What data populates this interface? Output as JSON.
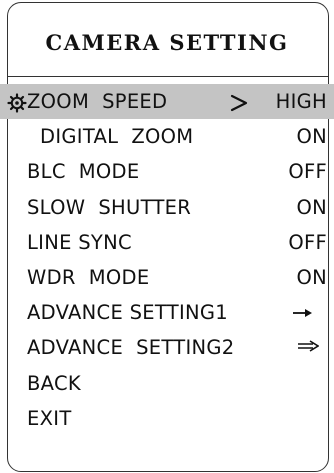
{
  "title": "CAMERA SETTING",
  "menu": {
    "items": [
      {
        "label": "ZOOM  SPEED",
        "value": "HIGH",
        "selected_icon": "gear-icon",
        "pointer_icon": "chevron-right-icon"
      },
      {
        "label": "DIGITAL  ZOOM",
        "value": "ON"
      },
      {
        "label": "BLC  MODE",
        "value": "OFF"
      },
      {
        "label": "SLOW  SHUTTER",
        "value": "ON"
      },
      {
        "label": "LINE SYNC",
        "value": "OFF"
      },
      {
        "label": "WDR  MODE",
        "value": "ON"
      },
      {
        "label": "ADVANCE SETTING1",
        "submenu_icon": "arrow-right-icon"
      },
      {
        "label": "ADVANCE  SETTING2",
        "submenu_icon": "arrow-right-icon"
      },
      {
        "label": "BACK"
      },
      {
        "label": "EXIT"
      }
    ]
  },
  "colors": {
    "selection": "#c4c4c4",
    "text": "#111111",
    "border": "#333333"
  }
}
